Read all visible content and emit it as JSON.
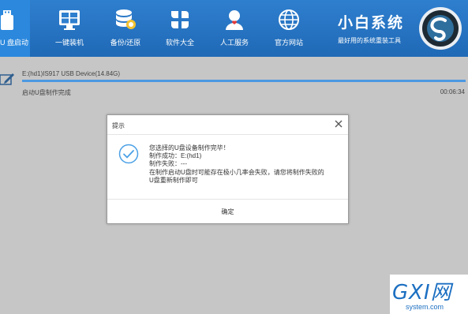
{
  "nav": {
    "items": [
      {
        "label": "U 盘启动",
        "icon": "usb-drive-icon",
        "active": true
      },
      {
        "label": "一键装机",
        "icon": "monitor-icon",
        "active": false
      },
      {
        "label": "备份/还原",
        "icon": "database-icon",
        "active": false
      },
      {
        "label": "软件大全",
        "icon": "apps-icon",
        "active": false
      },
      {
        "label": "人工服务",
        "icon": "support-person-icon",
        "active": false
      },
      {
        "label": "官方网站",
        "icon": "globe-icon",
        "active": false
      }
    ],
    "brand_title": "小白系统",
    "brand_subtitle": "最好用的系统重装工具",
    "accent_color": "#2b88dd",
    "bar_color": "#1f69b6"
  },
  "device": {
    "name": "E:(hd1)IS917 USB Device(14.84G)",
    "status": "启动U盘制作完成",
    "elapsed": "00:06:34",
    "progress": 1.0
  },
  "dialog": {
    "title": "提示",
    "lines": [
      "您选择的U盘设备制作完毕！",
      "制作成功：E:(hd1)",
      "制作失败：---",
      "在制作启动U盘时可能存在极小几率会失败，请您将制作失败的",
      "U盘重新制作即可"
    ],
    "ok_label": "确定"
  },
  "watermark": {
    "text": "GXI网",
    "site": "system.com"
  }
}
